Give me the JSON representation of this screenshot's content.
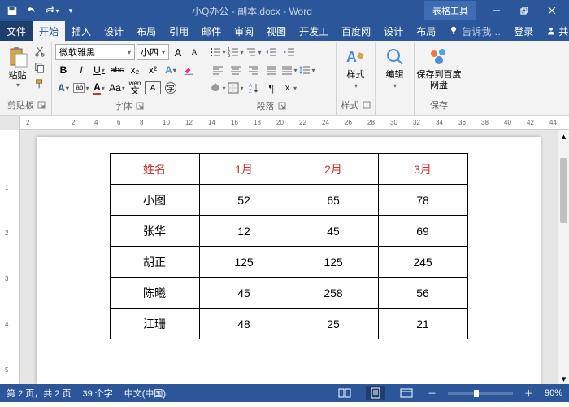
{
  "title": "小Q办公 - 副本.docx - Word",
  "tableTools": "表格工具",
  "qat": {
    "save": "保存",
    "undo": "撤销",
    "redo": "恢复"
  },
  "win": {
    "min": "最小化",
    "restore": "还原",
    "close": "关闭"
  },
  "tabs": {
    "file": "文件",
    "home": "开始",
    "insert": "插入",
    "design": "设计",
    "layout": "布局",
    "references": "引用",
    "mailings": "邮件",
    "review": "审阅",
    "view": "视图",
    "dev": "开发工",
    "baidu": "百度网",
    "tDesign": "设计",
    "tLayout": "布局",
    "tell": "告诉我…",
    "login": "登录",
    "share": "共享"
  },
  "ribbon": {
    "clipboard": {
      "label": "剪贴板",
      "paste": "粘贴"
    },
    "font": {
      "label": "字体",
      "name": "微软雅黑",
      "size": "小四",
      "grow": "A",
      "shrink": "A",
      "ruby": "wén",
      "char": "A",
      "clear": "◈",
      "bold": "B",
      "italic": "I",
      "underline": "U",
      "strike": "abc",
      "sub": "x₂",
      "sup": "x²",
      "effect": "A",
      "highlight": "ab",
      "color": "A",
      "case": "Aa",
      "enclosed": "字"
    },
    "paragraph": {
      "label": "段落"
    },
    "styles": {
      "label": "样式",
      "btn": "样式"
    },
    "editing": {
      "label": "编辑",
      "btn": "编辑"
    },
    "save": {
      "label": "保存",
      "btn": "保存到百度网盘"
    }
  },
  "ruler": {
    "marks": [
      "2",
      "",
      "2",
      "4",
      "6",
      "8",
      "10",
      "12",
      "14",
      "16",
      "18",
      "20",
      "22",
      "24",
      "26",
      "28",
      "30",
      "32",
      "34",
      "36",
      "38",
      "40",
      "42",
      "44"
    ],
    "v": [
      "",
      "1",
      "2",
      "3",
      "4",
      "5"
    ]
  },
  "table": {
    "header": [
      "姓名",
      "1月",
      "2月",
      "3月"
    ],
    "rows": [
      [
        "小图",
        "52",
        "65",
        "78"
      ],
      [
        "张华",
        "12",
        "45",
        "69"
      ],
      [
        "胡正",
        "125",
        "125",
        "245"
      ],
      [
        "陈曦",
        "45",
        "258",
        "56"
      ],
      [
        "江珊",
        "48",
        "25",
        "21"
      ]
    ]
  },
  "status": {
    "page": "第 2 页，共 2 页",
    "words": "39 个字",
    "lang": "中文(中国)",
    "zoom": "90%"
  }
}
